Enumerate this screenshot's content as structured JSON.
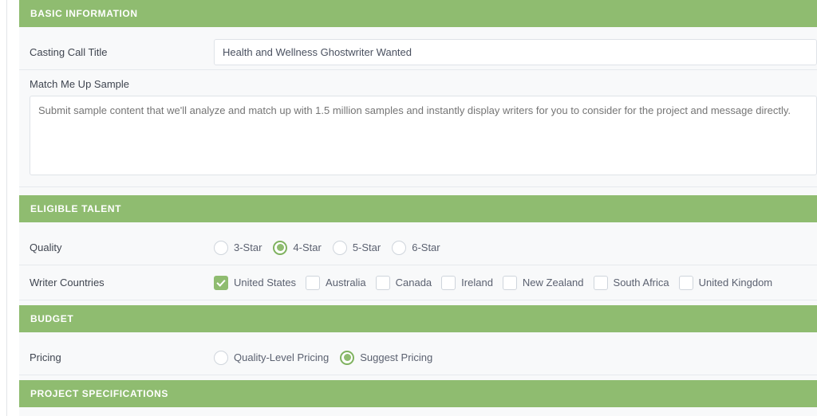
{
  "sections": {
    "basic_information": {
      "header": "BASIC INFORMATION",
      "title_field": {
        "label": "Casting Call Title",
        "value": "Health and Wellness Ghostwriter Wanted",
        "placeholder": ""
      },
      "sample_field": {
        "label": "Match Me Up Sample",
        "value": "",
        "placeholder": "Submit sample content that we'll analyze and match up with 1.5 million samples and instantly display writers for you to consider for the project and message directly."
      }
    },
    "eligible_talent": {
      "header": "ELIGIBLE TALENT",
      "quality": {
        "label": "Quality",
        "options": [
          {
            "label": "3-Star",
            "selected": false
          },
          {
            "label": "4-Star",
            "selected": true
          },
          {
            "label": "5-Star",
            "selected": false
          },
          {
            "label": "6-Star",
            "selected": false
          }
        ]
      },
      "writer_countries": {
        "label": "Writer Countries",
        "options": [
          {
            "label": "United States",
            "checked": true
          },
          {
            "label": "Australia",
            "checked": false
          },
          {
            "label": "Canada",
            "checked": false
          },
          {
            "label": "Ireland",
            "checked": false
          },
          {
            "label": "New Zealand",
            "checked": false
          },
          {
            "label": "South Africa",
            "checked": false
          },
          {
            "label": "United Kingdom",
            "checked": false
          }
        ]
      }
    },
    "budget": {
      "header": "BUDGET",
      "pricing": {
        "label": "Pricing",
        "options": [
          {
            "label": "Quality-Level Pricing",
            "selected": false
          },
          {
            "label": "Suggest Pricing",
            "selected": true
          }
        ]
      }
    },
    "project_specifications": {
      "header": "PROJECT SPECIFICATIONS"
    }
  },
  "colors": {
    "section_header_green": "#8fbc70",
    "accent_green": "#7fb25f",
    "panel_background": "#f8f9fa",
    "field_border": "#dfe3e8",
    "label_text": "#3f4550",
    "placeholder_text": "#8e97a6"
  }
}
